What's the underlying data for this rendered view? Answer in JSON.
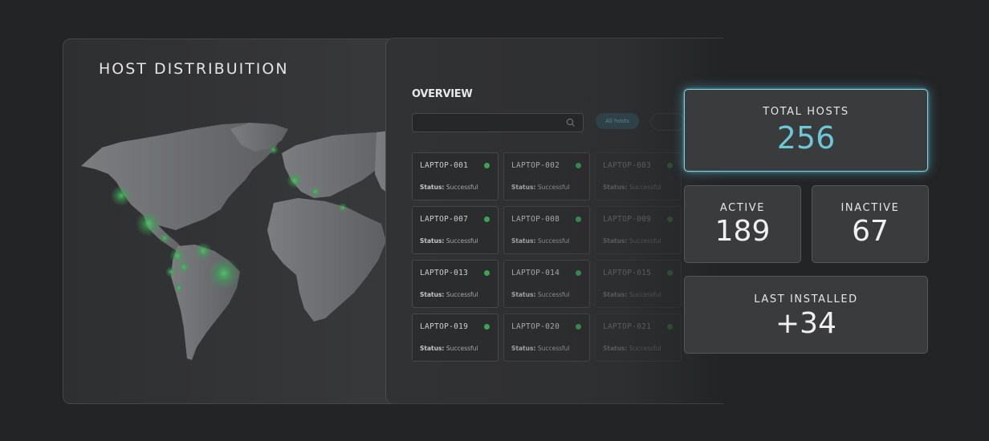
{
  "map_panel": {
    "title": "HOST DISTRIBUITION"
  },
  "overview": {
    "title": "OVERVIEW",
    "search": {
      "placeholder": "",
      "value": ""
    },
    "filter_label": "All hosts",
    "hosts": [
      {
        "name": "LAPTOP-001",
        "status_label": "Status:",
        "status": "Successful"
      },
      {
        "name": "LAPTOP-002",
        "status_label": "Status:",
        "status": "Successful"
      },
      {
        "name": "LAPTOP-003",
        "status_label": "Status:",
        "status": "Successful"
      },
      {
        "name": "LAPTOP-007",
        "status_label": "Status:",
        "status": "Successful"
      },
      {
        "name": "LAPTOP-008",
        "status_label": "Status:",
        "status": "Successful"
      },
      {
        "name": "LAPTOP-009",
        "status_label": "Status:",
        "status": "Successful"
      },
      {
        "name": "LAPTOP-013",
        "status_label": "Status:",
        "status": "Successful"
      },
      {
        "name": "LAPTOP-014",
        "status_label": "Status:",
        "status": "Successful"
      },
      {
        "name": "LAPTOP-015",
        "status_label": "Status:",
        "status": "Successful"
      },
      {
        "name": "LAPTOP-019",
        "status_label": "Status:",
        "status": "Successful"
      },
      {
        "name": "LAPTOP-020",
        "status_label": "Status:",
        "status": "Successful"
      },
      {
        "name": "LAPTOP-021",
        "status_label": "Status:",
        "status": "Successful"
      }
    ],
    "status_dot_color": "#3aa552"
  },
  "stats": {
    "total": {
      "label": "TOTAL HOSTS",
      "value": "256",
      "accent": "#6cc7d6"
    },
    "active": {
      "label": "ACTIVE",
      "value": "189"
    },
    "inactive": {
      "label": "INACTIVE",
      "value": "67"
    },
    "last_installed": {
      "label": "LAST INSTALLED",
      "value": "+34"
    }
  },
  "icons": {
    "search": "search-icon",
    "status": "status-dot-icon"
  }
}
